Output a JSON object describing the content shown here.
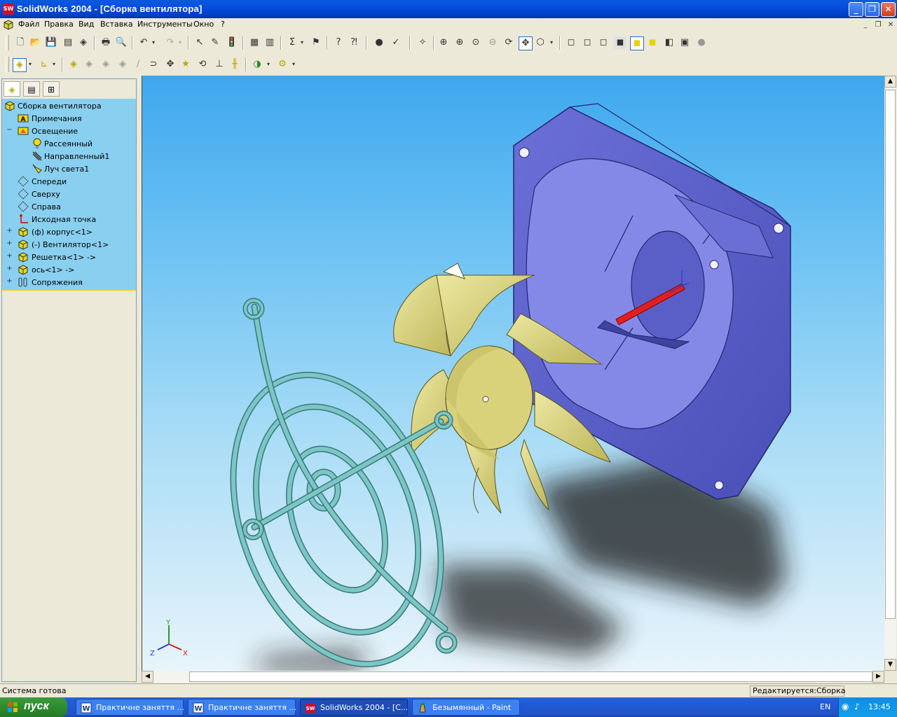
{
  "window": {
    "title": "SolidWorks 2004 - [Сборка вентилятора]",
    "app_icon_text": "SW"
  },
  "menu": {
    "items": [
      "Файл",
      "Правка",
      "Вид",
      "Вставка",
      "Инструменты",
      "Окно",
      "?"
    ]
  },
  "feature_tree": {
    "items": [
      {
        "label": "Сборка вентилятора",
        "icon": "assembly-icon",
        "expander": ""
      },
      {
        "label": "Примечания",
        "icon": "annotations-icon",
        "expander": ""
      },
      {
        "label": "Освещение",
        "icon": "lighting-icon",
        "expander": "−"
      },
      {
        "label": "Рассеянный",
        "icon": "ambient-light-icon",
        "expander": ""
      },
      {
        "label": "Направленный1",
        "icon": "directional-light-icon",
        "expander": ""
      },
      {
        "label": "Луч света1",
        "icon": "spot-light-icon",
        "expander": ""
      },
      {
        "label": "Спереди",
        "icon": "plane-icon",
        "expander": ""
      },
      {
        "label": "Сверху",
        "icon": "plane-icon",
        "expander": ""
      },
      {
        "label": "Справа",
        "icon": "plane-icon",
        "expander": ""
      },
      {
        "label": "Исходная точка",
        "icon": "origin-icon",
        "expander": ""
      },
      {
        "label": "(ф) корпус<1>",
        "icon": "part-icon",
        "expander": "+"
      },
      {
        "label": "(-) Вентилятор<1>",
        "icon": "part-icon",
        "expander": "+"
      },
      {
        "label": "Решетка<1> ->",
        "icon": "part-icon",
        "expander": "+"
      },
      {
        "label": "ось<1> ->",
        "icon": "part-icon",
        "expander": "+"
      },
      {
        "label": "Сопряжения",
        "icon": "mates-icon",
        "expander": "+"
      }
    ]
  },
  "triad": {
    "x": "X",
    "y": "Y",
    "z": "Z"
  },
  "status": {
    "left": "Система готова",
    "right": "Редактируется:Сборка"
  },
  "taskbar": {
    "start": "пуск",
    "tasks": [
      {
        "label": "Практичне заняття ...",
        "icon": "word-icon",
        "active": false
      },
      {
        "label": "Практичне заняття ...",
        "icon": "word-icon",
        "active": false
      },
      {
        "label": "SolidWorks 2004 - [С...",
        "icon": "solidworks-icon",
        "active": true
      },
      {
        "label": "Безымянный - Paint",
        "icon": "paint-icon",
        "active": false
      }
    ],
    "language": "EN",
    "clock": "13:45"
  },
  "colors": {
    "housing": "#5a5fc8",
    "blades": "#d9d27a",
    "grille": "#7cc6c6",
    "shaft": "#e02020"
  }
}
